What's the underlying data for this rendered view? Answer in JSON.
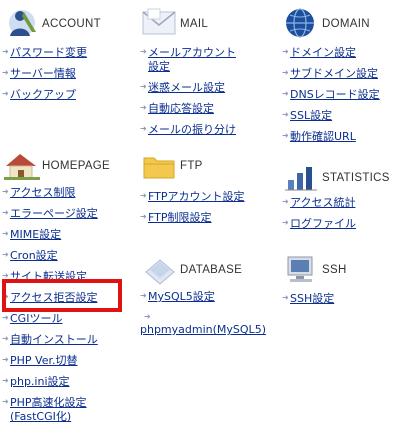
{
  "account": {
    "title": "ACCOUNT",
    "icon": "account-icon",
    "items": [
      "パスワード変更",
      "サーバー情報",
      "バックアップ"
    ]
  },
  "mail": {
    "title": "MAIL",
    "icon": "mail-icon",
    "items": [
      "メールアカウント設定",
      "迷惑メール設定",
      "自動応答設定",
      "メールの振り分け"
    ]
  },
  "domain": {
    "title": "DOMAIN",
    "icon": "globe-icon",
    "items": [
      "ドメイン設定",
      "サブドメイン設定",
      "DNSレコード設定",
      "SSL設定",
      "動作確認URL"
    ]
  },
  "homepage": {
    "title": "HOMEPAGE",
    "icon": "house-icon",
    "items": [
      "アクセス制限",
      "エラーページ設定",
      "MIME設定",
      "Cron設定",
      "サイト転送設定",
      "アクセス拒否設定",
      "CGIツール",
      "自動インストール",
      "PHP Ver.切替",
      "php.ini設定",
      "PHP高速化設定(FastCGI化)"
    ]
  },
  "ftp": {
    "title": "FTP",
    "icon": "folder-icon",
    "items": [
      "FTPアカウント設定",
      "FTP制限設定"
    ]
  },
  "statistics": {
    "title": "STATISTICS",
    "icon": "statistics-icon",
    "items": [
      "アクセス統計",
      "ログファイル"
    ]
  },
  "database": {
    "title": "DATABASE",
    "icon": "database-icon",
    "items": [
      "MySQL5設定",
      "phpmyadmin(MySQL5)"
    ]
  },
  "ssh": {
    "title": "SSH",
    "icon": "computer-icon",
    "items": [
      "SSH設定"
    ]
  },
  "highlight": {
    "target": "アクセス拒否設定",
    "color": "#e01212"
  }
}
